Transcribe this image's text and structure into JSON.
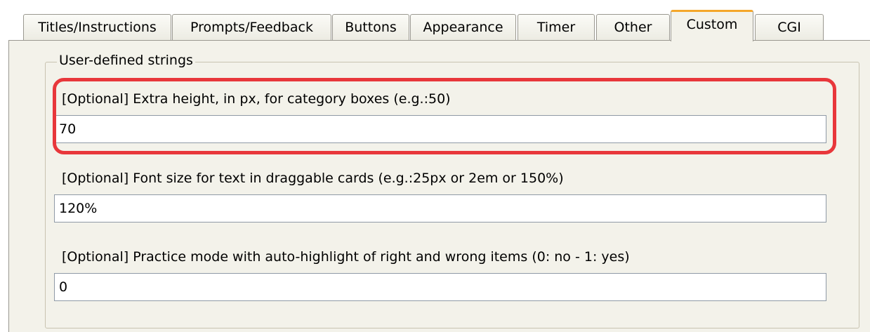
{
  "tabs": [
    {
      "label": "Titles/Instructions"
    },
    {
      "label": "Prompts/Feedback"
    },
    {
      "label": "Buttons"
    },
    {
      "label": "Appearance"
    },
    {
      "label": "Timer"
    },
    {
      "label": "Other"
    },
    {
      "label": "Custom",
      "active": true
    },
    {
      "label": "CGI"
    }
  ],
  "group": {
    "title": "User-defined strings"
  },
  "fields": [
    {
      "label": "[Optional] Extra height, in px, for category boxes (e.g.:50)",
      "value": "70",
      "highlighted": true
    },
    {
      "label": "[Optional] Font size for text in draggable cards (e.g.:25px or 2em or 150%)",
      "value": "120%"
    },
    {
      "label": "[Optional] Practice mode with auto-highlight of right and wrong items (0: no - 1: yes)",
      "value": "0"
    }
  ],
  "colors": {
    "active_tab_accent": "#f4a62a",
    "highlight_outline": "#e8373b",
    "panel_background": "#f3f2ea"
  }
}
